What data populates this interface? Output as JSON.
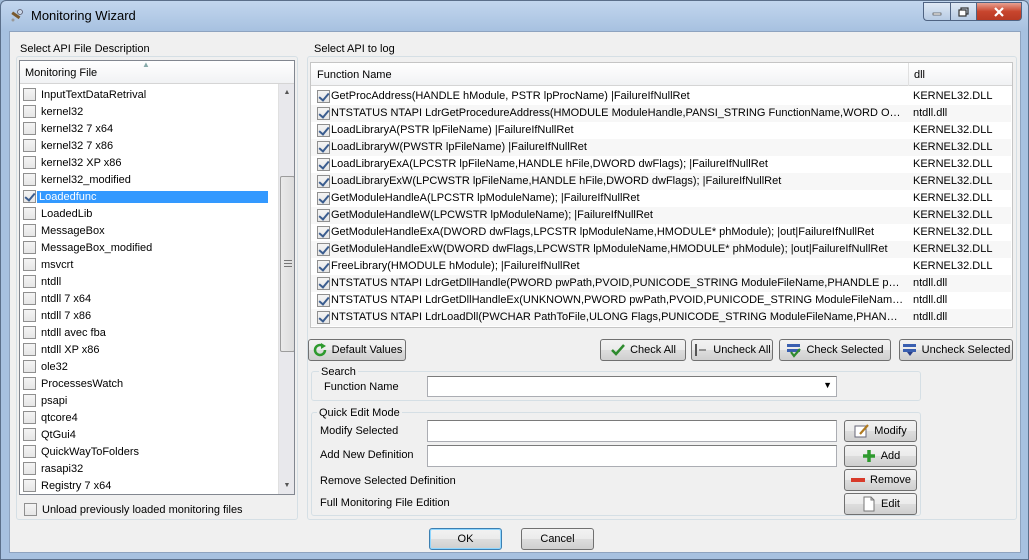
{
  "window": {
    "title": "Monitoring Wizard"
  },
  "left_panel": {
    "title": "Select API File Description",
    "column_header": "Monitoring File",
    "items": [
      {
        "label": "InputTextDataRetrival",
        "checked": false
      },
      {
        "label": "kernel32",
        "checked": false
      },
      {
        "label": "kernel32 7 x64",
        "checked": false
      },
      {
        "label": "kernel32 7 x86",
        "checked": false
      },
      {
        "label": "kernel32 XP x86",
        "checked": false
      },
      {
        "label": "kernel32_modified",
        "checked": false
      },
      {
        "label": "Loadedfunc",
        "checked": true,
        "selected": true
      },
      {
        "label": "LoadedLib",
        "checked": false
      },
      {
        "label": "MessageBox",
        "checked": false
      },
      {
        "label": "MessageBox_modified",
        "checked": false
      },
      {
        "label": "msvcrt",
        "checked": false
      },
      {
        "label": "ntdll",
        "checked": false
      },
      {
        "label": "ntdll 7 x64",
        "checked": false
      },
      {
        "label": "ntdll 7 x86",
        "checked": false
      },
      {
        "label": "ntdll avec fba",
        "checked": false
      },
      {
        "label": "ntdll XP x86",
        "checked": false
      },
      {
        "label": "ole32",
        "checked": false
      },
      {
        "label": "ProcessesWatch",
        "checked": false
      },
      {
        "label": "psapi",
        "checked": false
      },
      {
        "label": "qtcore4",
        "checked": false
      },
      {
        "label": "QtGui4",
        "checked": false
      },
      {
        "label": "QuickWayToFolders",
        "checked": false
      },
      {
        "label": "rasapi32",
        "checked": false
      },
      {
        "label": "Registry 7 x64",
        "checked": false
      }
    ],
    "unload_label": "Unload previously loaded monitoring files",
    "unload_checked": false
  },
  "right_panel": {
    "title": "Select API to log",
    "col_function": "Function Name",
    "col_dll": "dll",
    "rows": [
      {
        "fn": "GetProcAddress(HANDLE hModule, PSTR lpProcName) |FailureIfNullRet",
        "dll": "KERNEL32.DLL",
        "checked": true
      },
      {
        "fn": "NTSTATUS NTAPI LdrGetProcedureAddress(HMODULE ModuleHandle,PANSI_STRING FunctionName,WORD Ordinal,P...",
        "dll": "ntdll.dll",
        "checked": true
      },
      {
        "fn": "LoadLibraryA(PSTR lpFileName) |FailureIfNullRet",
        "dll": "KERNEL32.DLL",
        "checked": true
      },
      {
        "fn": "LoadLibraryW(PWSTR lpFileName) |FailureIfNullRet",
        "dll": "KERNEL32.DLL",
        "checked": true
      },
      {
        "fn": "LoadLibraryExA(LPCSTR lpFileName,HANDLE hFile,DWORD dwFlags); |FailureIfNullRet",
        "dll": "KERNEL32.DLL",
        "checked": true
      },
      {
        "fn": "LoadLibraryExW(LPCWSTR lpFileName,HANDLE hFile,DWORD dwFlags); |FailureIfNullRet",
        "dll": "KERNEL32.DLL",
        "checked": true
      },
      {
        "fn": "GetModuleHandleA(LPCSTR lpModuleName); |FailureIfNullRet",
        "dll": "KERNEL32.DLL",
        "checked": true
      },
      {
        "fn": "GetModuleHandleW(LPCWSTR lpModuleName); |FailureIfNullRet",
        "dll": "KERNEL32.DLL",
        "checked": true
      },
      {
        "fn": "GetModuleHandleExA(DWORD dwFlags,LPCSTR lpModuleName,HMODULE* phModule); |out|FailureIfNullRet",
        "dll": "KERNEL32.DLL",
        "checked": true
      },
      {
        "fn": "GetModuleHandleExW(DWORD dwFlags,LPCWSTR lpModuleName,HMODULE* phModule); |out|FailureIfNullRet",
        "dll": "KERNEL32.DLL",
        "checked": true
      },
      {
        "fn": "FreeLibrary(HMODULE hModule); |FailureIfNullRet",
        "dll": "KERNEL32.DLL",
        "checked": true
      },
      {
        "fn": "NTSTATUS NTAPI LdrGetDllHandle(PWORD pwPath,PVOID,PUNICODE_STRING ModuleFileName,PHANDLE pHModule)...",
        "dll": "ntdll.dll",
        "checked": true
      },
      {
        "fn": "NTSTATUS NTAPI LdrGetDllHandleEx(UNKNOWN,PWORD pwPath,PVOID,PUNICODE_STRING ModuleFileName,PHAN...",
        "dll": "ntdll.dll",
        "checked": true
      },
      {
        "fn": "NTSTATUS NTAPI LdrLoadDll(PWCHAR PathToFile,ULONG Flags,PUNICODE_STRING ModuleFileName,PHANDLE Modu...",
        "dll": "ntdll.dll",
        "checked": true
      }
    ],
    "buttons": {
      "default_values": "Default Values",
      "check_all": "Check All",
      "uncheck_all": "Uncheck All",
      "check_selected": "Check Selected",
      "uncheck_selected": "Uncheck Selected"
    }
  },
  "search": {
    "title": "Search",
    "function_name_label": "Function Name",
    "value": ""
  },
  "quick_edit": {
    "title": "Quick Edit Mode",
    "modify_label": "Modify Selected",
    "modify_value": "",
    "add_label": "Add New Definition",
    "add_value": "",
    "remove_label": "Remove Selected Definition",
    "full_label": "Full Monitoring File Edition",
    "modify_button": "Modify",
    "add_button": "Add",
    "remove_button": "Remove",
    "edit_button": "Edit"
  },
  "footer": {
    "ok": "OK",
    "cancel": "Cancel"
  },
  "colors": {
    "selection": "#3399ff",
    "title_bar": "#a7c1e0"
  }
}
